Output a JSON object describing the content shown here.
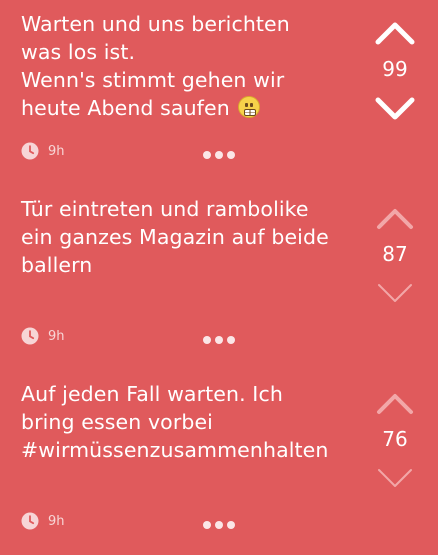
{
  "posts": [
    {
      "text": "Warten und uns berichten\nwas los ist.\nWenn's stimmt gehen wir\nheute Abend saufen",
      "emoji": "grimacing-face",
      "time": "9h",
      "score": "99",
      "vote_state": "neutral"
    },
    {
      "text": "Tür eintreten und rambolike\nein ganzes Magazin auf beide\nballern",
      "emoji": "",
      "time": "9h",
      "score": "87",
      "vote_state": "muted"
    },
    {
      "text": "Auf jeden Fall warten. Ich\nbring essen vorbei\n#wirmüssenzusammenhalten",
      "emoji": "",
      "time": "9h",
      "score": "76",
      "vote_state": "muted"
    }
  ],
  "colors": {
    "background": "#e05a5c",
    "foreground": "#ffffff",
    "muted_arrow": "#f2a7a8"
  },
  "icons": {
    "time": "clock-icon",
    "more": "more-dots-icon",
    "upvote": "chevron-up-icon",
    "downvote": "chevron-down-icon"
  }
}
